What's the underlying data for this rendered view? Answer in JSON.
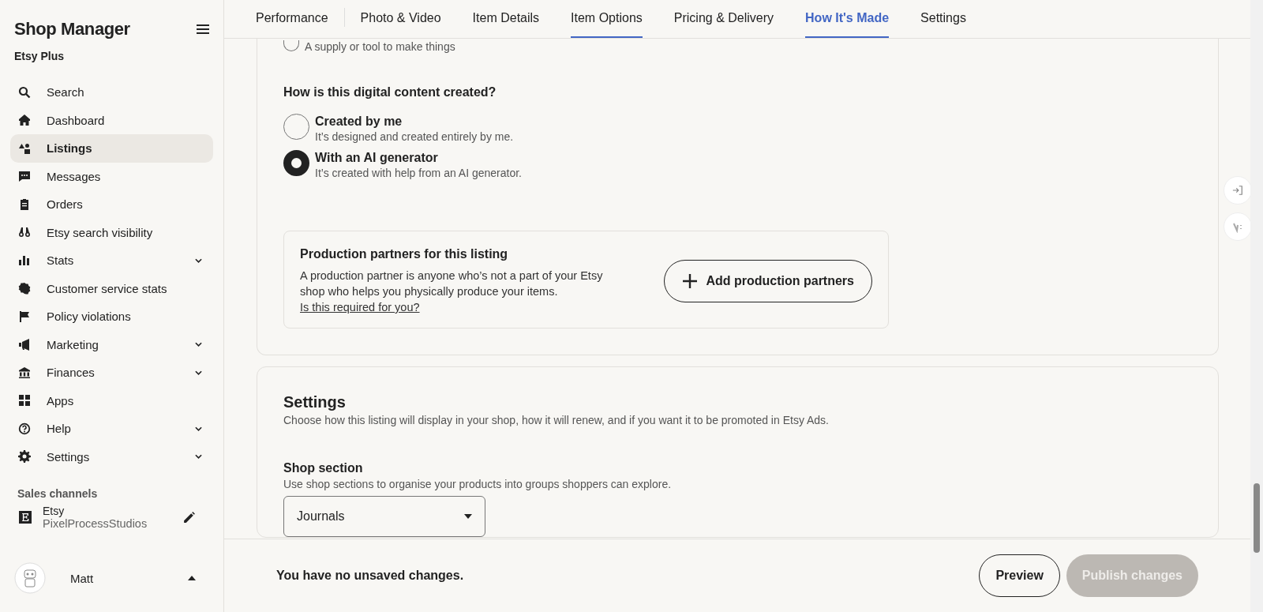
{
  "sidebar": {
    "title": "Shop Manager",
    "subtitle": "Etsy Plus",
    "items": [
      {
        "label": "Search",
        "selected": false,
        "expandable": false
      },
      {
        "label": "Dashboard",
        "selected": false,
        "expandable": false
      },
      {
        "label": "Listings",
        "selected": true,
        "expandable": false
      },
      {
        "label": "Messages",
        "selected": false,
        "expandable": false
      },
      {
        "label": "Orders",
        "selected": false,
        "expandable": false
      },
      {
        "label": "Etsy search visibility",
        "selected": false,
        "expandable": false
      },
      {
        "label": "Stats",
        "selected": false,
        "expandable": true
      },
      {
        "label": "Customer service stats",
        "selected": false,
        "expandable": false
      },
      {
        "label": "Policy violations",
        "selected": false,
        "expandable": false
      },
      {
        "label": "Marketing",
        "selected": false,
        "expandable": true
      },
      {
        "label": "Finances",
        "selected": false,
        "expandable": true
      },
      {
        "label": "Apps",
        "selected": false,
        "expandable": false
      },
      {
        "label": "Help",
        "selected": false,
        "expandable": true
      },
      {
        "label": "Settings",
        "selected": false,
        "expandable": true
      }
    ],
    "sales_channels": {
      "heading": "Sales channels",
      "channel": "Etsy",
      "shop": "PixelProcessStudios"
    },
    "user": {
      "name": "Matt"
    }
  },
  "tabs": [
    {
      "label": "Performance",
      "selected": false,
      "underlined": false
    },
    {
      "label": "Photo & Video",
      "selected": false,
      "underlined": false
    },
    {
      "label": "Item Details",
      "selected": false,
      "underlined": false
    },
    {
      "label": "Item Options",
      "selected": false,
      "underlined": true
    },
    {
      "label": "Pricing & Delivery",
      "selected": false,
      "underlined": false
    },
    {
      "label": "How It's Made",
      "selected": true,
      "underlined": true
    },
    {
      "label": "Settings",
      "selected": false,
      "underlined": false
    }
  ],
  "cut_option": {
    "label": "A supply or tool to make things",
    "selected": false
  },
  "creation": {
    "question": "How is this digital content created?",
    "options": [
      {
        "label": "Created by me",
        "description": "It’s designed and created entirely by me.",
        "selected": false
      },
      {
        "label": "With an AI generator",
        "description": "It’s created with help from an AI generator.",
        "selected": true
      }
    ]
  },
  "partners": {
    "title": "Production partners for this listing",
    "text": "A production partner is anyone who’s not a part of your Etsy shop who helps you physically produce your items.",
    "link": "Is this required for you?",
    "button": "Add production partners"
  },
  "settings": {
    "title": "Settings",
    "description": "Choose how this listing will display in your shop, how it will renew, and if you want it to be promoted in Etsy Ads.",
    "shop_section": {
      "label": "Shop section",
      "hint": "Use shop sections to organise your products into groups shoppers can explore.",
      "value": "Journals"
    }
  },
  "footer": {
    "status": "You have no unsaved changes.",
    "preview": "Preview",
    "publish": "Publish changes",
    "publish_disabled": true
  }
}
